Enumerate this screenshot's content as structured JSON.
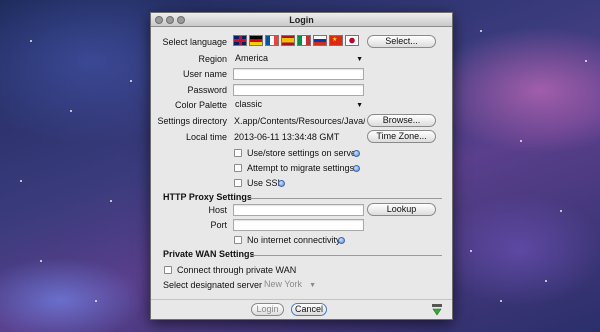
{
  "window": {
    "title": "Login"
  },
  "form": {
    "select_language": {
      "label": "Select language",
      "button": "Select..."
    },
    "flags": [
      {
        "name": "uk-flag-icon",
        "colors": [
          "#012169",
          "#ffffff",
          "#c8102e"
        ]
      },
      {
        "name": "germany-flag-icon",
        "colors": [
          "#000000",
          "#dd0000",
          "#ffce00"
        ]
      },
      {
        "name": "france-flag-icon",
        "colors": [
          "#0055a4",
          "#ffffff",
          "#ef4135"
        ]
      },
      {
        "name": "spain-flag-icon",
        "colors": [
          "#aa151b",
          "#f1bf00",
          "#aa151b"
        ]
      },
      {
        "name": "italy-flag-icon",
        "colors": [
          "#009246",
          "#ffffff",
          "#ce2b37"
        ]
      },
      {
        "name": "russia-flag-icon",
        "colors": [
          "#ffffff",
          "#0039a6",
          "#d52b1e"
        ]
      },
      {
        "name": "china-flag-icon",
        "colors": [
          "#de2910",
          "#de2910",
          "#de2910"
        ]
      },
      {
        "name": "japan-flag-icon",
        "colors": [
          "#ffffff",
          "#ffffff",
          "#ffffff"
        ]
      }
    ],
    "region": {
      "label": "Region",
      "value": "America"
    },
    "user_name": {
      "label": "User name",
      "value": ""
    },
    "password": {
      "label": "Password",
      "value": ""
    },
    "color_palette": {
      "label": "Color Palette",
      "value": "classic"
    },
    "settings_directory": {
      "label": "Settings directory",
      "value": "X.app/Contents/Resources/Java/.",
      "button": "Browse..."
    },
    "local_time": {
      "label": "Local time",
      "value": "2013-06-11 13:34:48 GMT",
      "button": "Time Zone..."
    },
    "checkboxes": [
      {
        "label": "Use/store settings on server",
        "checked": false
      },
      {
        "label": "Attempt to migrate settings",
        "checked": false
      },
      {
        "label": "Use SSL",
        "checked": false
      }
    ]
  },
  "proxy": {
    "title": "HTTP Proxy Settings",
    "host": {
      "label": "Host",
      "value": ""
    },
    "port": {
      "label": "Port",
      "value": ""
    },
    "lookup_button": "Lookup",
    "no_internet": {
      "label": "No internet connectivity",
      "checked": false
    }
  },
  "wan": {
    "title": "Private WAN Settings",
    "connect": {
      "label": "Connect through private WAN",
      "checked": false
    },
    "server": {
      "label": "Select designated server",
      "value": "New York"
    }
  },
  "footer": {
    "login": "Login",
    "cancel": "Cancel"
  },
  "colors": {
    "accent": "#4a78c8",
    "window_bg": "#e8e8e8"
  }
}
